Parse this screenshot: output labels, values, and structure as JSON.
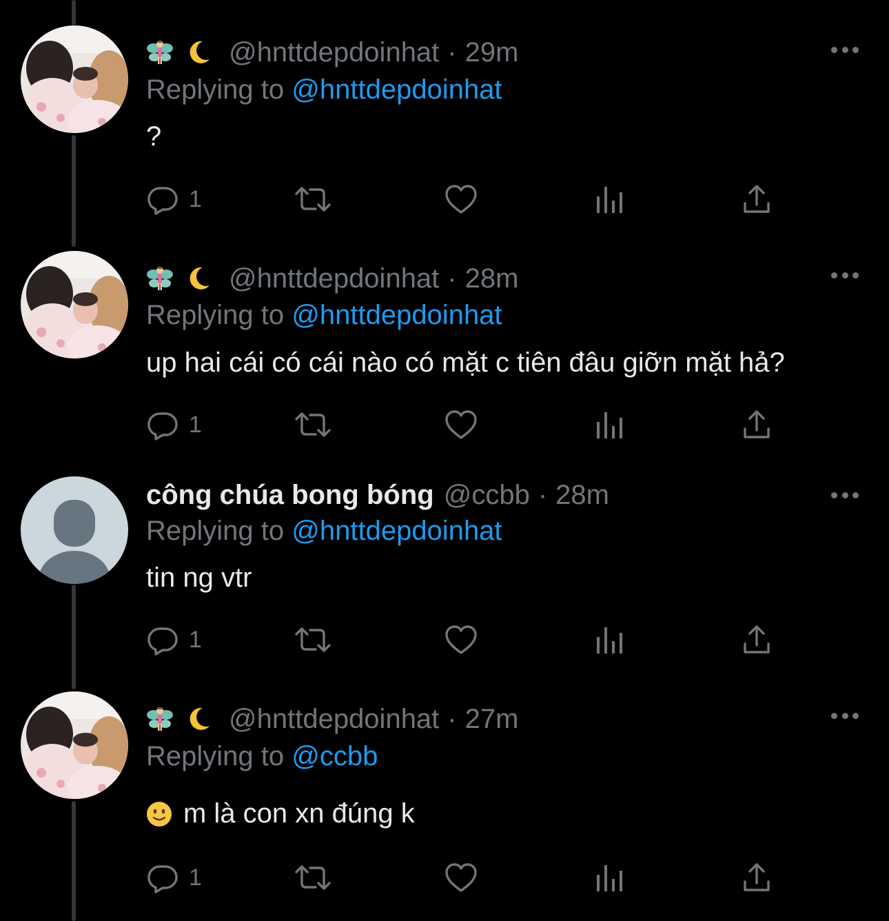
{
  "colors": {
    "background": "#000000",
    "text": "#e7e9ea",
    "muted": "#71767b",
    "link": "#1d9bf0",
    "thread_line": "#333639"
  },
  "icons": {
    "reply": "reply-icon",
    "retweet": "retweet-icon",
    "like": "heart-icon",
    "views": "views-bar-chart-icon",
    "share": "share-icon",
    "more": "more-dots-icon",
    "name_emojis": [
      "fairy-emoji",
      "crescent-moon-emoji"
    ],
    "body_emoji": "slightly-smiling-face-emoji"
  },
  "tweets": [
    {
      "handle": "@hnttdepdoinhat",
      "separator": "·",
      "time": "29m",
      "replying_prefix": "Replying to",
      "replying_to": "@hnttdepdoinhat",
      "text": "?",
      "reply_count": "1"
    },
    {
      "handle": "@hnttdepdoinhat",
      "separator": "·",
      "time": "28m",
      "replying_prefix": "Replying to",
      "replying_to": "@hnttdepdoinhat",
      "text": "up hai cái có cái nào có mặt c tiên đâu giỡn mặt hả?",
      "reply_count": "1"
    },
    {
      "display_name": "công chúa bong bóng",
      "handle": "@ccbb",
      "separator": "·",
      "time": "28m",
      "replying_prefix": "Replying to",
      "replying_to": "@hnttdepdoinhat",
      "text": "tin ng vtr",
      "reply_count": "1"
    },
    {
      "handle": "@hnttdepdoinhat",
      "separator": "·",
      "time": "27m",
      "replying_prefix": "Replying to",
      "replying_to": "@ccbb",
      "text": "m là con xn đúng k",
      "reply_count": "1"
    }
  ]
}
